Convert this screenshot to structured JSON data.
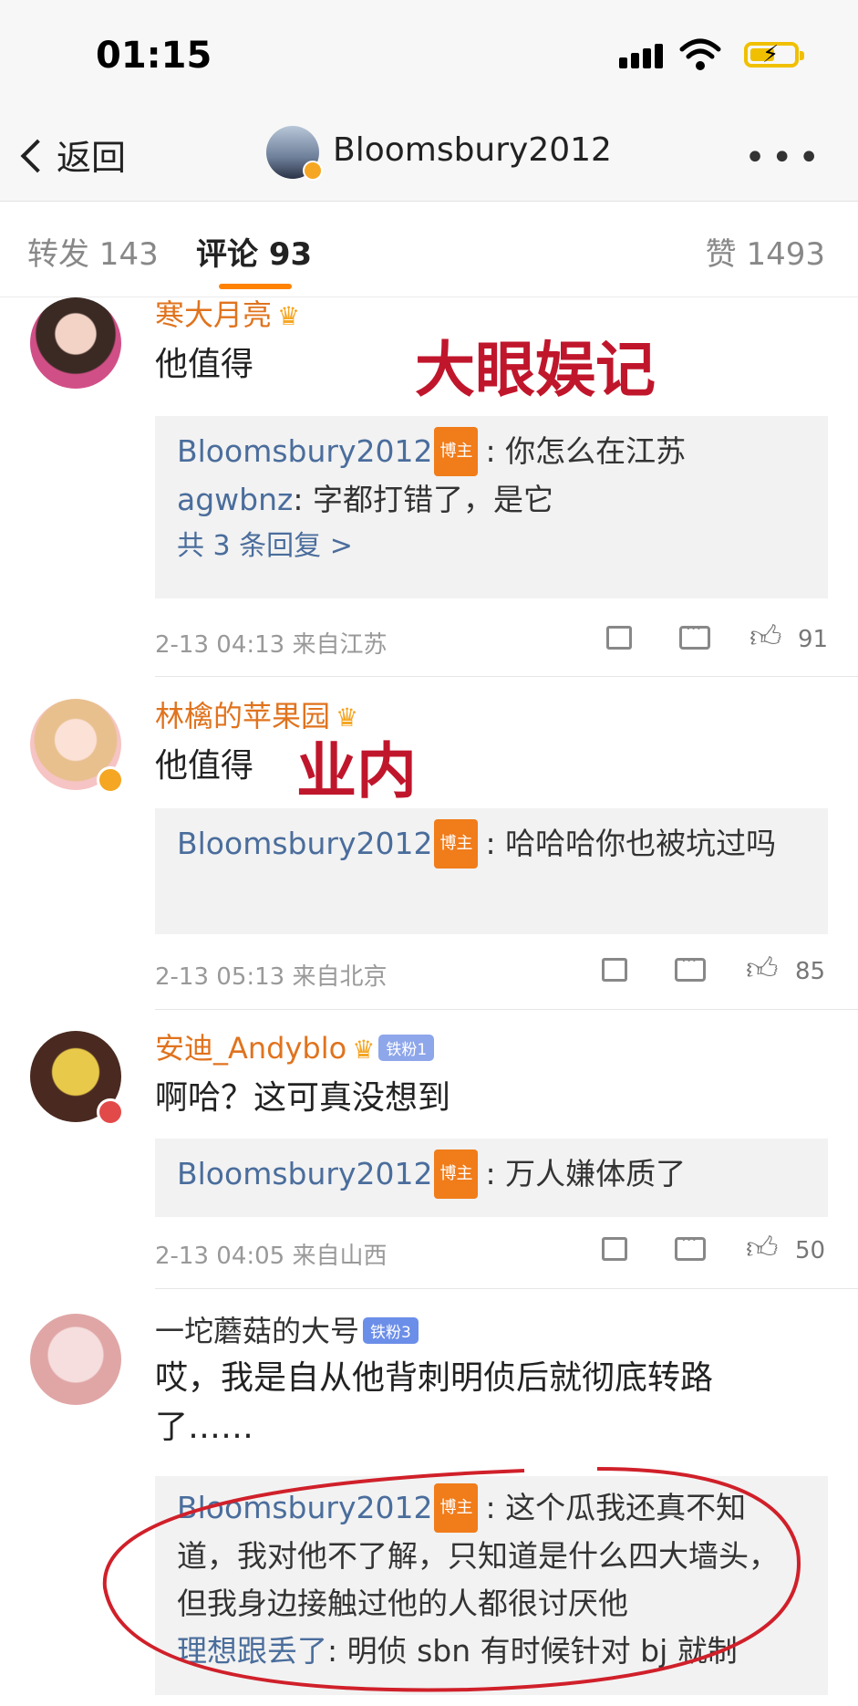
{
  "status_bar": {
    "time": "01:15"
  },
  "nav": {
    "back_label": "返回",
    "title": "Bloomsbury2012",
    "more": "•••"
  },
  "tabs": [
    {
      "label": "转发 143"
    },
    {
      "label": "评论 93"
    },
    {
      "label": "赞 1493"
    }
  ],
  "comments": [
    {
      "name": "寒大月亮",
      "text": "他值得",
      "annotation": "大眼娱记",
      "replies": [
        {
          "user": "Bloomsbury2012",
          "badge": "博主",
          "text": ": 你怎么在江苏"
        },
        {
          "user": "agwbnz",
          "badge": "",
          "text": ": 字都打错了，是它"
        }
      ],
      "more_replies": "共 3 条回复 >",
      "meta": "2-13 04:13  来自江苏",
      "likes": "91"
    },
    {
      "name": "林檎的苹果园",
      "text": "他值得",
      "annotation": "业内",
      "replies": [
        {
          "user": "Bloomsbury2012",
          "badge": "博主",
          "text": ": 哈哈哈你也被坑过吗"
        }
      ],
      "meta": "2-13 05:13  来自北京",
      "likes": "85"
    },
    {
      "name": "安迪_Andyblo",
      "fan_badge": "铁粉1",
      "text": "啊哈？这可真没想到",
      "replies": [
        {
          "user": "Bloomsbury2012",
          "badge": "博主",
          "text": ": 万人嫌体质了"
        }
      ],
      "meta": "2-13 04:05  来自山西",
      "likes": "50"
    },
    {
      "name": "一坨蘑菇的大号",
      "fan_badge": "铁粉3",
      "text": "哎，我是自从他背刺明侦后就彻底转路了……",
      "replies": [
        {
          "user": "Bloomsbury2012",
          "badge": "博主",
          "text": ": 这个瓜我还真不知道，我对他不了解，只知道是什么四大墙头，但我身边接触过他的人都很讨厌他"
        },
        {
          "user": "理想跟丢了",
          "badge": "",
          "text": ": 明侦 sbn 有时候针对 bj 就制"
        }
      ]
    }
  ],
  "colors": {
    "accent": "#ff8200",
    "name_orange": "#e0731e",
    "link_blue": "#4a6d9c",
    "annotation_red": "#c0162c"
  }
}
